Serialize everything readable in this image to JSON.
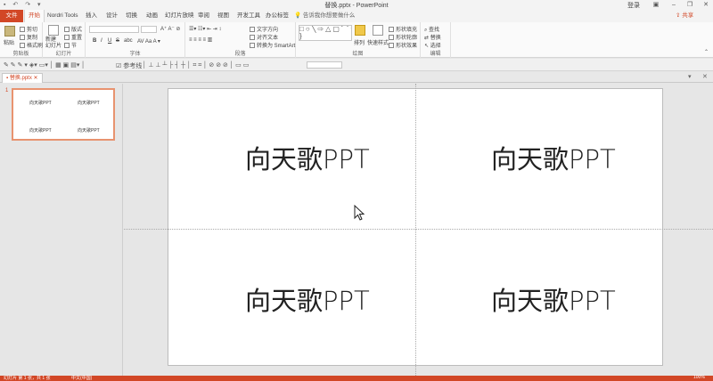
{
  "window": {
    "title": "替换.pptx - PowerPoint",
    "login": "登录"
  },
  "tabs": {
    "file": "文件",
    "items": [
      "开始",
      "Nordri Tools",
      "插入",
      "设计",
      "切换",
      "动画",
      "幻灯片放映",
      "审阅",
      "视图",
      "开发工具",
      "办公标签"
    ],
    "tell_me": "告诉我你想要做什么",
    "share": "共享"
  },
  "ribbon": {
    "clipboard": {
      "label": "剪贴板",
      "paste": "粘贴",
      "cut": "剪切",
      "copy": "复制",
      "format_painter": "格式刷"
    },
    "slides": {
      "label": "幻灯片",
      "new_slide": "新建\n幻灯片",
      "layout": "版式",
      "reset": "重置",
      "section": "节"
    },
    "font": {
      "label": "字体",
      "bold": "B",
      "italic": "I",
      "underline": "U",
      "strike": "S",
      "shadow": "abc"
    },
    "paragraph": {
      "label": "段落",
      "text_direction": "文字方向",
      "align_text": "对齐文本",
      "smartart": "转换为 SmartArt"
    },
    "drawing": {
      "label": "绘图",
      "arrange": "排列",
      "quick_styles": "快速样式",
      "fill": "形状填充",
      "outline": "形状轮廓",
      "effects": "形状效果"
    },
    "editing": {
      "label": "编辑",
      "find": "查找",
      "replace": "替换",
      "select": "选择"
    }
  },
  "toolbar2": {
    "reference_line": "参考线"
  },
  "document": {
    "tab": "替换.pptx",
    "slide_number": "1",
    "thumb_texts": [
      "向天歌PPT",
      "向天歌PPT",
      "向天歌PPT",
      "向天歌PPT"
    ],
    "slide_texts": [
      "向天歌PPT",
      "向天歌PPT",
      "向天歌PPT",
      "向天歌PPT"
    ]
  },
  "status": {
    "slide_info": "幻灯片 第 1 张，共 1 张",
    "language": "中文(中国)",
    "zoom": "100%"
  },
  "colors": {
    "accent": "#d24726",
    "thumb_border": "#e8936f"
  }
}
